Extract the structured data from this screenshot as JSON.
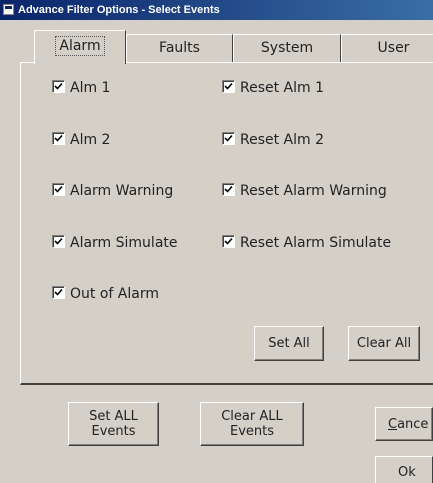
{
  "window": {
    "title": "Advance Filter Options - Select Events"
  },
  "tabs": [
    {
      "label": "Alarm",
      "active": true
    },
    {
      "label": "Faults",
      "active": false
    },
    {
      "label": "System",
      "active": false
    },
    {
      "label": "User",
      "active": false
    }
  ],
  "checkboxes": {
    "alm1": {
      "label": "Alm 1",
      "checked": true
    },
    "reset_alm1": {
      "label": "Reset Alm 1",
      "checked": true
    },
    "alm2": {
      "label": "Alm 2",
      "checked": true
    },
    "reset_alm2": {
      "label": "Reset Alm 2",
      "checked": true
    },
    "alarm_warning": {
      "label": "Alarm Warning",
      "checked": true
    },
    "reset_alarm_warning": {
      "label": "Reset Alarm Warning",
      "checked": true
    },
    "alarm_simulate": {
      "label": "Alarm Simulate",
      "checked": true
    },
    "reset_alarm_simulate": {
      "label": "Reset Alarm Simulate",
      "checked": true
    },
    "out_of_alarm": {
      "label": "Out of Alarm",
      "checked": true
    }
  },
  "buttons": {
    "set_all": "Set All",
    "clear_all": "Clear All",
    "set_all_events": "Set ALL\nEvents",
    "clear_all_events": "Clear ALL\nEvents",
    "cancel": "Cance",
    "ok": "Ok"
  }
}
